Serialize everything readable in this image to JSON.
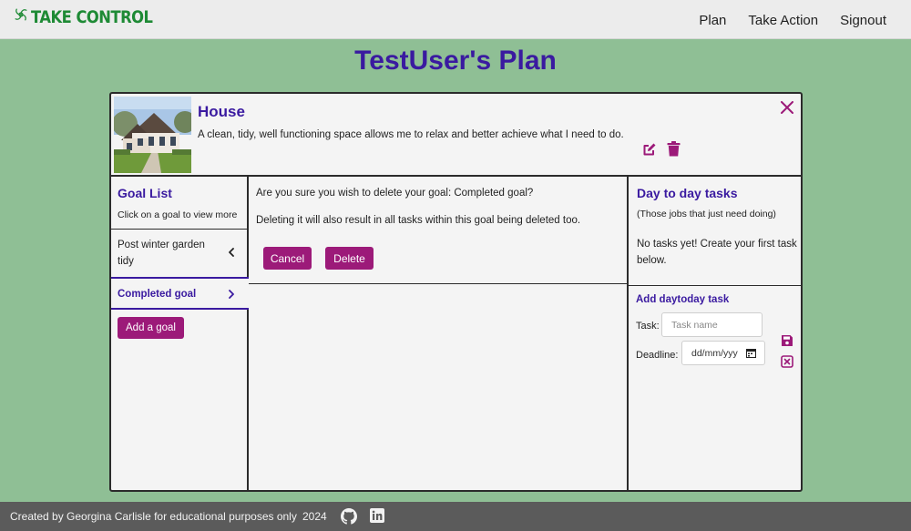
{
  "nav": {
    "brand": "TAKE CONTROL",
    "links": [
      "Plan",
      "Take Action",
      "Signout"
    ]
  },
  "page_title": "TestUser's Plan",
  "area": {
    "title": "House",
    "description": "A clean, tidy, well functioning space allows me to relax and better achieve what I need to do."
  },
  "goal_list": {
    "title": "Goal List",
    "hint": "Click on a goal to view more",
    "goals": [
      "Post winter garden tidy",
      "Completed goal"
    ],
    "add_label": "Add a goal"
  },
  "confirm": {
    "question": "Are you sure you wish to delete your goal: Completed goal?",
    "warning": "Deleting it will also result in all tasks within this goal being deleted too.",
    "cancel_label": "Cancel",
    "delete_label": "Delete"
  },
  "tasks": {
    "title": "Day to day tasks",
    "subtitle": "(Those jobs that just need doing)",
    "empty": "No tasks yet! Create your first task below.",
    "form_title": "Add daytoday task",
    "task_label": "Task:",
    "task_placeholder": "Task name",
    "deadline_label": "Deadline:",
    "date_placeholder": "dd/mm/yyy"
  },
  "footer": {
    "text": "Created by Georgina Carlisle for educational purposes only",
    "year": "2024"
  },
  "colors": {
    "page_bg": "#8fbf95",
    "brand_green": "#1e8a35",
    "heading_purple": "#3a1aa0",
    "accent_magenta": "#9c1a79",
    "footer_bg": "#5b5b5b"
  }
}
